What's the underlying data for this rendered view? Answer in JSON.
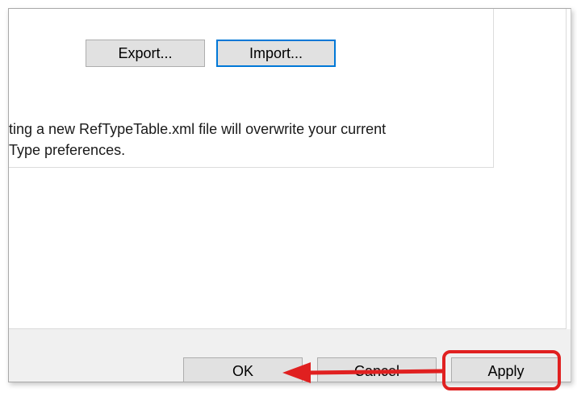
{
  "transfer": {
    "export_label": "Export...",
    "import_label": "Import..."
  },
  "warning": {
    "line1": "ting a new RefTypeTable.xml file will overwrite your current",
    "line2": "Type preferences."
  },
  "footer": {
    "ok_label": "OK",
    "cancel_label": "Cancel",
    "apply_label": "Apply"
  },
  "annotation": {
    "color": "#e02020",
    "highlight_target": "apply-button",
    "arrow_target": "ok-button"
  }
}
